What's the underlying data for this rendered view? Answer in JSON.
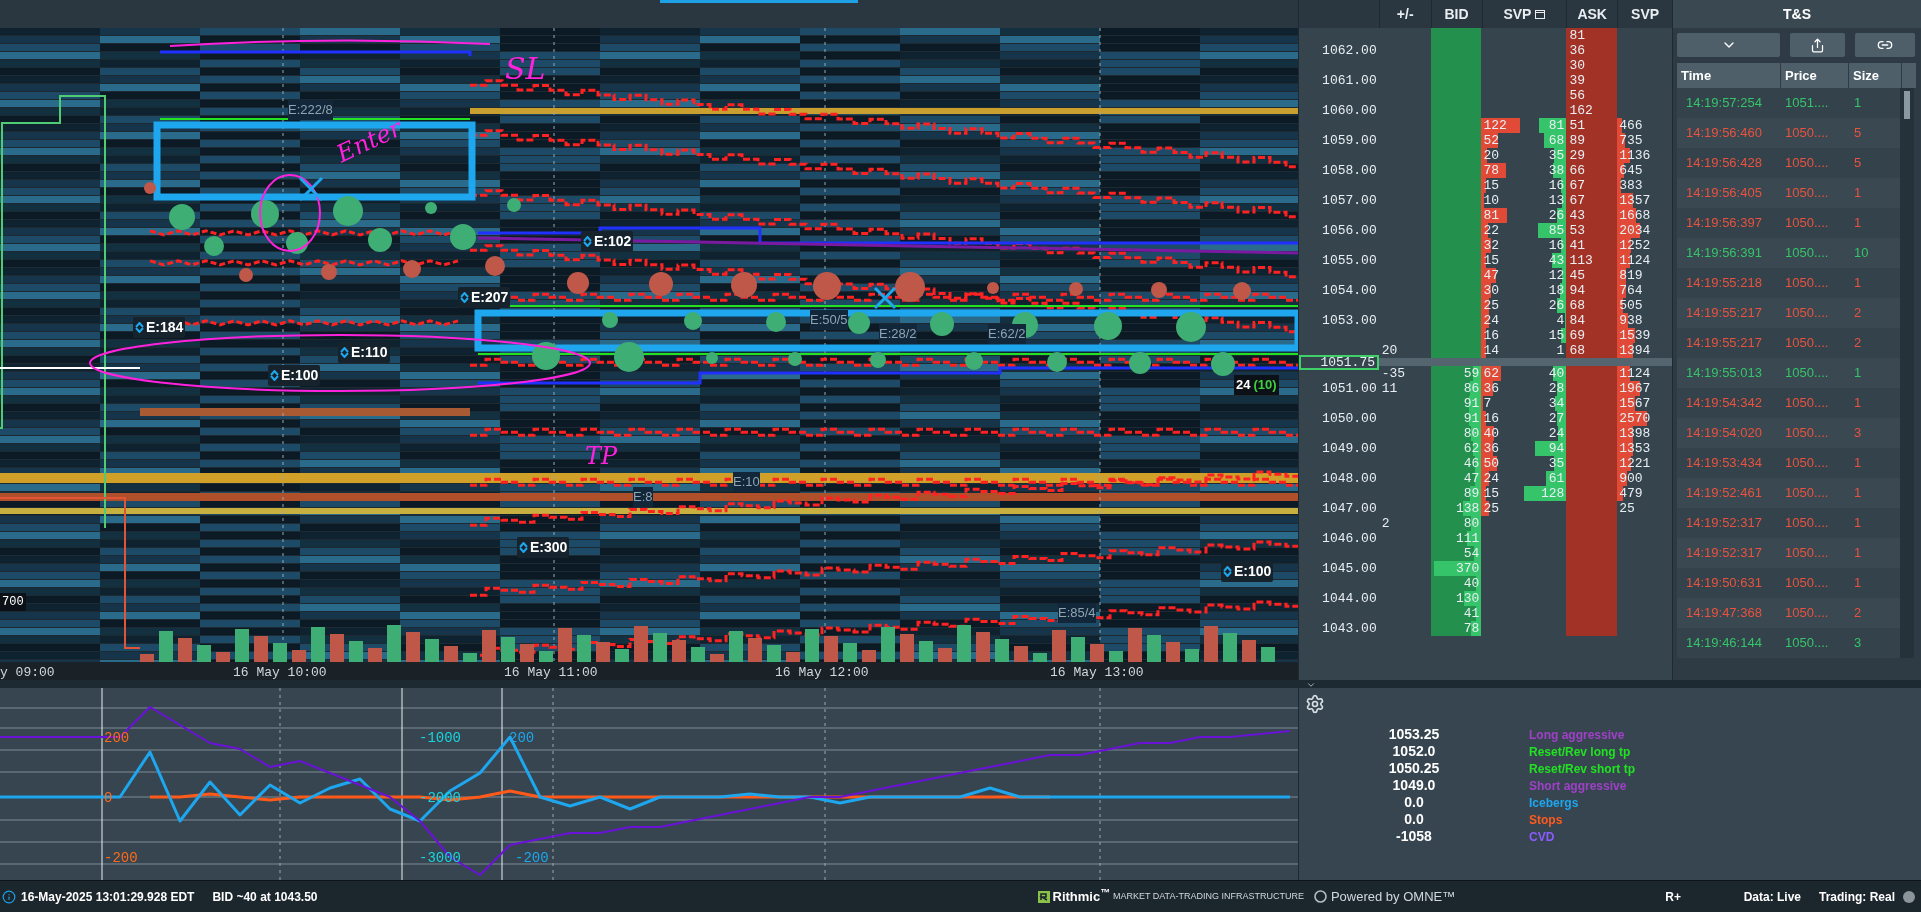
{
  "chart": {
    "time_labels": [
      "y 09:00",
      "16 May 10:00",
      "16 May 11:00",
      "16 May 12:00",
      "16 May 13:00"
    ],
    "event_labels": [
      "E:184",
      "E:110",
      "E:100",
      "E:207",
      "E:102",
      "E:300",
      "E:100"
    ],
    "faded_labels": [
      "E:222/8",
      "E:50/5",
      "E:28/2",
      "E:62/2",
      "E:10",
      "E:8",
      "E:85/4"
    ],
    "annotations": [
      "SL",
      "Enter",
      "TP"
    ],
    "price_tag": "700",
    "last_size": "24",
    "last_count": "(10)"
  },
  "indicator": {
    "chart_data": {
      "type": "line",
      "yticks": [
        {
          "value": 200,
          "label": "200"
        },
        {
          "value": 0,
          "label": "0"
        },
        {
          "value": -200,
          "label": "-200"
        }
      ],
      "ylim": [
        -276.7,
        363.3
      ],
      "y2lim": [
        -3383.3,
        -183.3
      ],
      "y2ticks": [
        {
          "value": -1000,
          "label": "-1000"
        },
        {
          "value": -2000,
          "label": "-2000"
        },
        {
          "value": -3000,
          "label": "-3000"
        }
      ],
      "annotations": [
        {
          "text": "200"
        },
        {
          "text": "-200"
        }
      ],
      "series": [
        {
          "color": "#ff5a1a",
          "values": [
            null,
            null,
            null,
            null,
            null,
            0,
            0,
            10,
            0,
            -10,
            0,
            0,
            0,
            0,
            0,
            -10,
            0,
            20,
            0,
            0,
            0,
            0,
            0,
            0,
            0,
            0,
            0,
            0,
            0,
            0,
            0,
            0,
            0,
            0,
            0,
            0,
            null,
            null,
            null,
            null,
            null,
            null,
            null,
            null
          ]
        },
        {
          "color": "#1ea6ee",
          "values": [
            0,
            0,
            0,
            0,
            0,
            150,
            -80,
            50,
            -60,
            40,
            -20,
            30,
            60,
            -40,
            -80,
            20,
            80,
            200,
            0,
            -30,
            0,
            -40,
            0,
            0,
            0,
            10,
            0,
            0,
            -20,
            0,
            0,
            0,
            0,
            30,
            0,
            0,
            0,
            0,
            0,
            0,
            0,
            0,
            0,
            0
          ]
        },
        {
          "color": "#6a12d8",
          "axis": "y2",
          "values": [
            -1000,
            -1000,
            -1000,
            -1000,
            -1000,
            -500,
            -800,
            -1100,
            -1200,
            -1500,
            -1400,
            -1600,
            -1800,
            -2000,
            -2400,
            -3000,
            -3300,
            -2800,
            -2700,
            -2600,
            -2600,
            -2500,
            -2500,
            -2400,
            -2300,
            -2200,
            -2100,
            -2000,
            -2000,
            -1900,
            -1800,
            -1700,
            -1600,
            -1500,
            -1400,
            -1300,
            -1300,
            -1200,
            -1100,
            -1100,
            -1000,
            -1000,
            -950,
            -900
          ]
        }
      ]
    }
  },
  "dom": {
    "columns": [
      "+/-",
      "BID",
      "SVP",
      "ASK",
      "SVP"
    ],
    "rows": [
      {
        "ask": "81"
      },
      {
        "price": "1062.00",
        "ask": "36"
      },
      {
        "ask": "30"
      },
      {
        "price": "1061.00",
        "ask": "39"
      },
      {
        "ask": "56"
      },
      {
        "price": "1060.00",
        "ask": "162"
      },
      {
        "sell": "122",
        "buy": "81",
        "ask": "51",
        "volume": "466"
      },
      {
        "price": "1059.00",
        "sell": "52",
        "buy": "68",
        "ask": "89",
        "volume": "735"
      },
      {
        "sell": "20",
        "buy": "35",
        "ask": "29",
        "volume": "1136"
      },
      {
        "price": "1058.00",
        "sell": "78",
        "buy": "38",
        "ask": "66",
        "volume": "645"
      },
      {
        "sell": "15",
        "buy": "16",
        "ask": "67",
        "volume": "383"
      },
      {
        "price": "1057.00",
        "sell": "10",
        "buy": "13",
        "ask": "67",
        "volume": "1357"
      },
      {
        "sell": "81",
        "buy": "26",
        "ask": "43",
        "volume": "1668"
      },
      {
        "price": "1056.00",
        "sell": "22",
        "buy": "85",
        "ask": "53",
        "volume": "2034"
      },
      {
        "sell": "32",
        "buy": "16",
        "ask": "41",
        "volume": "1252"
      },
      {
        "price": "1055.00",
        "sell": "15",
        "buy": "43",
        "ask": "113",
        "volume": "1124"
      },
      {
        "sell": "47",
        "buy": "12",
        "ask": "45",
        "volume": "819"
      },
      {
        "price": "1054.00",
        "sell": "30",
        "buy": "18",
        "ask": "94",
        "volume": "764"
      },
      {
        "sell": "25",
        "buy": "26",
        "ask": "68",
        "volume": "505"
      },
      {
        "price": "1053.00",
        "sell": "24",
        "buy": "4",
        "ask": "84",
        "volume": "938"
      },
      {
        "sell": "16",
        "buy": "15",
        "ask": "69",
        "volume": "1539"
      },
      {
        "change": "20",
        "sell": "14",
        "buy": "1",
        "ask": "68",
        "volume": "1394"
      },
      {
        "kind": "last",
        "price": "1051.75"
      },
      {
        "change": "-35",
        "bid": "59",
        "sell": "62",
        "buy": "40",
        "volume": "1124"
      },
      {
        "price": "1051.00",
        "change": "11",
        "bid": "86",
        "sell": "36",
        "buy": "28",
        "volume": "1967"
      },
      {
        "bid": "91",
        "sell": "7",
        "buy": "34",
        "volume": "1567"
      },
      {
        "price": "1050.00",
        "bid": "91",
        "sell": "16",
        "buy": "27",
        "volume": "2570"
      },
      {
        "bid": "80",
        "sell": "40",
        "buy": "24",
        "volume": "1398"
      },
      {
        "price": "1049.00",
        "bid": "62",
        "sell": "36",
        "buy": "94",
        "volume": "1353"
      },
      {
        "bid": "46",
        "sell": "50",
        "buy": "35",
        "volume": "1221"
      },
      {
        "price": "1048.00",
        "bid": "47",
        "sell": "24",
        "buy": "61",
        "volume": "900"
      },
      {
        "bid": "89",
        "sell": "15",
        "buy": "128",
        "volume": "479"
      },
      {
        "price": "1047.00",
        "bid": "138",
        "sell": "25",
        "volume": "25"
      },
      {
        "change": "2",
        "bid": "80"
      },
      {
        "price": "1046.00",
        "bid": "111"
      },
      {
        "bid": "54"
      },
      {
        "price": "1045.00",
        "bid": "370"
      },
      {
        "bid": "40"
      },
      {
        "price": "1044.00",
        "bid": "130"
      },
      {
        "bid": "41"
      },
      {
        "price": "1043.00",
        "bid": "78"
      }
    ]
  },
  "tns": {
    "title": "T&S",
    "columns": [
      "Time",
      "Price",
      "Size"
    ],
    "rows": [
      {
        "time": "14:19:57:254",
        "price": "1051....",
        "size": "1",
        "color": "#35c46a"
      },
      {
        "time": "14:19:56:460",
        "price": "1050....",
        "size": "5",
        "color": "#e8533f"
      },
      {
        "time": "14:19:56:428",
        "price": "1050....",
        "size": "5",
        "color": "#e8533f"
      },
      {
        "time": "14:19:56:405",
        "price": "1050....",
        "size": "1",
        "color": "#e8533f"
      },
      {
        "time": "14:19:56:397",
        "price": "1050....",
        "size": "1",
        "color": "#e8533f"
      },
      {
        "time": "14:19:56:391",
        "price": "1050....",
        "size": "10",
        "color": "#35c46a"
      },
      {
        "time": "14:19:55:218",
        "price": "1050....",
        "size": "1",
        "color": "#e8533f"
      },
      {
        "time": "14:19:55:217",
        "price": "1050....",
        "size": "2",
        "color": "#e8533f"
      },
      {
        "time": "14:19:55:217",
        "price": "1050....",
        "size": "2",
        "color": "#e8533f"
      },
      {
        "time": "14:19:55:013",
        "price": "1050....",
        "size": "1",
        "color": "#35c46a"
      },
      {
        "time": "14:19:54:342",
        "price": "1050....",
        "size": "1",
        "color": "#e8533f"
      },
      {
        "time": "14:19:54:020",
        "price": "1050....",
        "size": "3",
        "color": "#e8533f"
      },
      {
        "time": "14:19:53:434",
        "price": "1050....",
        "size": "1",
        "color": "#e8533f"
      },
      {
        "time": "14:19:52:461",
        "price": "1050....",
        "size": "1",
        "color": "#e8533f"
      },
      {
        "time": "14:19:52:317",
        "price": "1050....",
        "size": "1",
        "color": "#e8533f"
      },
      {
        "time": "14:19:52:317",
        "price": "1050....",
        "size": "1",
        "color": "#e8533f"
      },
      {
        "time": "14:19:50:631",
        "price": "1050....",
        "size": "1",
        "color": "#e8533f"
      },
      {
        "time": "14:19:47:368",
        "price": "1050....",
        "size": "2",
        "color": "#e8533f"
      },
      {
        "time": "14:19:46:144",
        "price": "1050....",
        "size": "3",
        "color": "#35c46a"
      }
    ]
  },
  "legend": {
    "items": [
      {
        "value": "1053.25",
        "label": "Long aggressive",
        "color": "#a040c8"
      },
      {
        "value": "1052.0",
        "label": "Reset/Rev long tp",
        "color": "#22e022"
      },
      {
        "value": "1050.25",
        "label": "Reset/Rev short tp",
        "color": "#22e022"
      },
      {
        "value": "1049.0",
        "label": "Short aggressive",
        "color": "#a040c8"
      },
      {
        "value": "0.0",
        "label": "Icebergs",
        "color": "#1ea6ee"
      },
      {
        "value": "0.0",
        "label": "Stops",
        "color": "#ff5a1e"
      },
      {
        "value": "-1058",
        "label": "CVD",
        "color": "#8a5cff"
      }
    ]
  },
  "status_bar": {
    "timestamp": "16-May-2025 13:01:29.928 EDT",
    "quote": "BID ~40 at 1043.50",
    "provider": "Rithmic$^{™}$",
    "tagline": "MARKET DATA-TRADING INFRASTRUCTURE",
    "powered": "Powered by OMNE™",
    "mode": "R+",
    "data": "Data: Live",
    "trading": "Trading: Real"
  }
}
